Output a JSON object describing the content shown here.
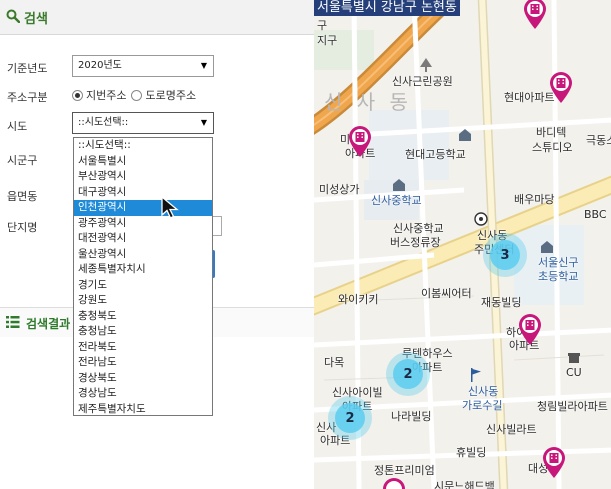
{
  "search": {
    "title": "검색",
    "year_label": "기준년도",
    "year_value": "2020년도",
    "address_label": "주소구분",
    "radio_jibun": "지번주소",
    "radio_road": "도로명주소",
    "sido_label": "시도",
    "sido_value": "::시도선택::",
    "sigungu_label": "시군구",
    "eupmyeon_label": "읍면동",
    "danji_label": "단지명"
  },
  "dropdown": {
    "options": [
      "::시도선택::",
      "서울특별시",
      "부산광역시",
      "대구광역시",
      "인천광역시",
      "광주광역시",
      "대전광역시",
      "울산광역시",
      "세종특별자치시",
      "경기도",
      "강원도",
      "충청북도",
      "충청남도",
      "전라북도",
      "전라남도",
      "경상북도",
      "경상남도",
      "제주특별자치도"
    ],
    "highlighted_index": 4
  },
  "results": {
    "title": "검색결과"
  },
  "map": {
    "title": "서울특별시 강남구 논현동",
    "labels": {
      "gu": "구",
      "jigu": "지구",
      "sinsa_park": "신사근린공원",
      "hyundai_apt1": "현대아파트",
      "sinsadong_big": "신 사 동",
      "mijin": "미진",
      "apt": "아파트",
      "hyundai_high": "현대고등학교",
      "bar": "바디텍",
      "studio": "스튜디오",
      "geuk": "극동스",
      "misung": "미성상가",
      "sinsa_middle": "신사중학교",
      "baewoo": "배우마당",
      "bbc": "BBC",
      "bus1": "신사중학교",
      "bus2": "버스정류장",
      "comm1": "신사동",
      "comm2": "주민센터",
      "seoul_elem1": "서울신구",
      "seoul_elem2": "초등학교",
      "waikiki": "와이키키",
      "ibum": "이봄씨어터",
      "jaedong": "재동빌딩",
      "hanyang1": "하이",
      "hanyang2": "아파트",
      "rooten1": "루텐하우스",
      "rooten2": "아파트",
      "dabok": "다목",
      "cu": "CU",
      "sinsa_ivil1": "신사아이빌",
      "sinsa_ivil2": "아파트",
      "sinsa_garo1": "신사동",
      "sinsa_garo2": "가로수길",
      "chungrim": "청림빌라아파트",
      "naraa": "나라빌딩",
      "sinsa_tower1": "신사",
      "sinsa_tower2": "아파트",
      "sinsa_villa": "신사빌라트",
      "jeongmun": "정톤프리미엄",
      "hyubil": "휴빌딩",
      "daesung": "대성",
      "simun": "시문느해드백"
    },
    "clusters": [
      {
        "count": "3"
      },
      {
        "count": "2"
      },
      {
        "count": "2"
      }
    ]
  },
  "colors": {
    "accent_green": "#3a7a2c",
    "highlight_blue": "#1e8ad8",
    "pin_magenta": "#c8177a",
    "cluster_cyan": "#5acdf0"
  }
}
